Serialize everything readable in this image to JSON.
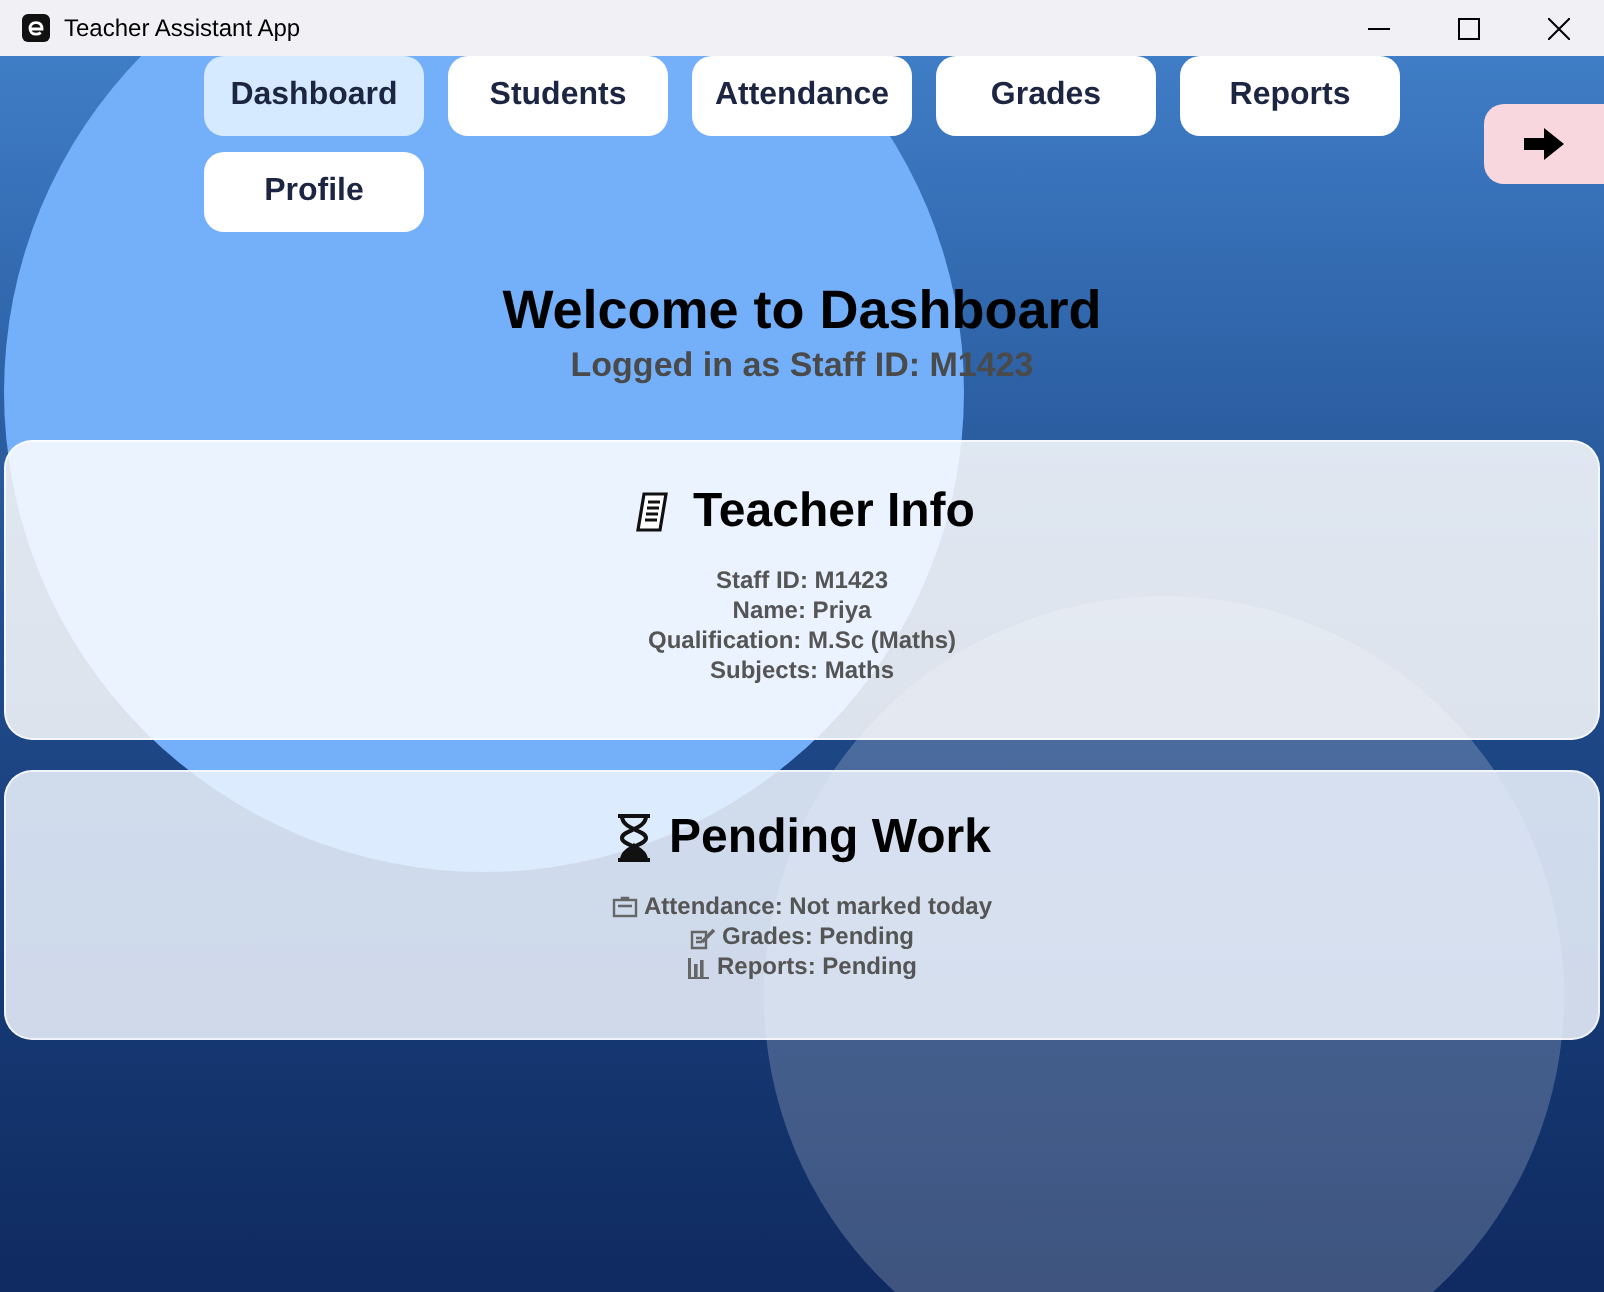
{
  "window": {
    "title": "Teacher Assistant App"
  },
  "nav": [
    {
      "label": "Dashboard",
      "selected": true
    },
    {
      "label": "Students",
      "selected": false
    },
    {
      "label": "Attendance",
      "selected": false
    },
    {
      "label": "Grades",
      "selected": false
    },
    {
      "label": "Reports",
      "selected": false
    },
    {
      "label": "Profile",
      "selected": false
    }
  ],
  "heading": "Welcome to Dashboard",
  "subtitle": "Logged in as Staff ID: M1423",
  "cards": [
    {
      "kind": "info",
      "title": "Teacher Info",
      "lines": [
        {
          "text": "Staff ID: M1423"
        },
        {
          "text": "Name: Priya"
        },
        {
          "text": "Qualification: M.Sc (Maths)"
        },
        {
          "text": "Subjects: Maths"
        }
      ]
    },
    {
      "kind": "pending",
      "title": "Pending Work",
      "lines": [
        {
          "kind": "attendance",
          "text": "Attendance: Not marked today"
        },
        {
          "kind": "grades",
          "text": "Grades: Pending"
        },
        {
          "kind": "reports",
          "text": "Reports: Pending"
        }
      ]
    }
  ]
}
